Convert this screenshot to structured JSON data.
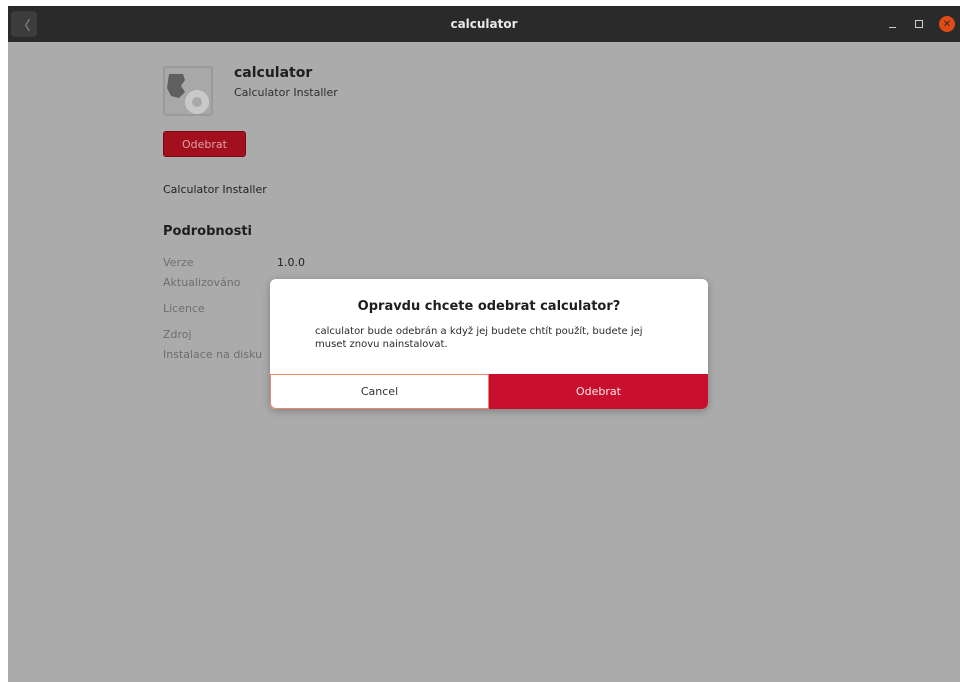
{
  "window": {
    "title": "calculator",
    "controls": {
      "minimize": "–",
      "maximize": "□",
      "close": "✕"
    },
    "back_icon": "〈"
  },
  "app": {
    "name": "calculator",
    "subtitle": "Calculator Installer",
    "remove_label": "Odebrat",
    "description": "Calculator Installer",
    "icon": "gear-icon"
  },
  "details": {
    "heading": "Podrobnosti",
    "rows": [
      {
        "label": "Verze",
        "value": "1.0.0"
      },
      {
        "label": "Aktualizováno",
        "value": ""
      },
      {
        "label": "Licence",
        "value": ""
      },
      {
        "label": "Zdroj",
        "value": ""
      },
      {
        "label": "Instalace na disku",
        "value": ""
      }
    ]
  },
  "dialog": {
    "title": "Opravdu chcete odebrat calculator?",
    "body": "calculator bude odebrán a když jej budete chtít použít, budete jej muset znovu nainstalovat.",
    "cancel_label": "Cancel",
    "confirm_label": "Odebrat"
  },
  "colors": {
    "titlebar": "#2a2a2a",
    "dim_background": "#ababab",
    "destructive": "#c8102e",
    "close_button": "#df4a16"
  }
}
